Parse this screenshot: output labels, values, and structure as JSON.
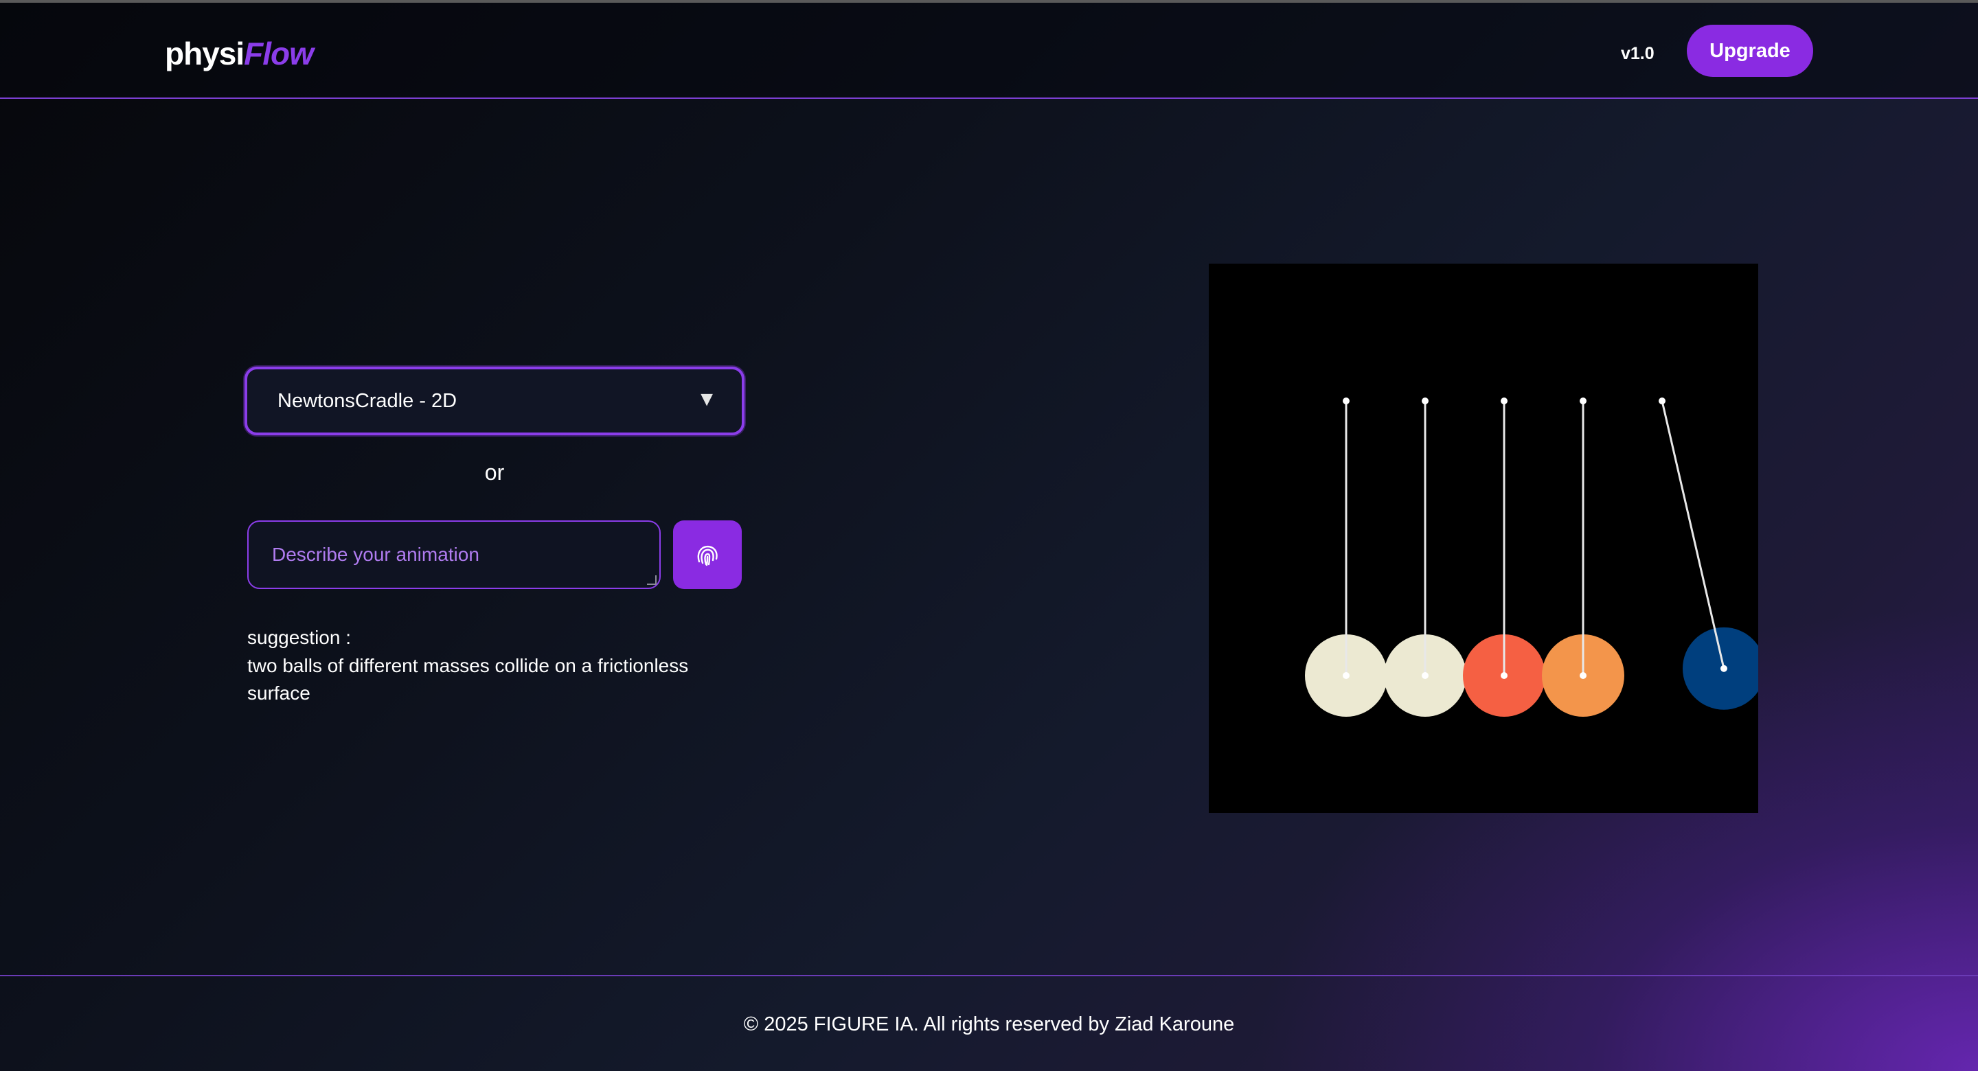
{
  "header": {
    "logo_part1": "physi",
    "logo_part2": "Flow",
    "version": "v1.0",
    "upgrade_label": "Upgrade"
  },
  "controls": {
    "selected_animation": "NewtonsCradle - 2D",
    "dropdown_arrow": "▼",
    "or_label": "or",
    "prompt_placeholder": "Describe your animation",
    "send_icon": "fingerprint-icon",
    "suggestion_title": "suggestion :",
    "suggestion_text": "two balls of different masses collide on a frictionless surface"
  },
  "animation": {
    "canvas_background": "#000000",
    "string_color": "#e8e8e8",
    "balls": [
      {
        "color": "#ece9d2",
        "swing_deg": 0
      },
      {
        "color": "#ece9d2",
        "swing_deg": 0
      },
      {
        "color": "#f56043",
        "swing_deg": 0
      },
      {
        "color": "#f3954b",
        "swing_deg": 0
      },
      {
        "color": "#003f7e",
        "swing_deg": 13
      }
    ]
  },
  "footer": {
    "copyright": "© 2025 FIGURE IA. All rights reserved by Ziad Karoune"
  },
  "colors": {
    "accent": "#8a2be2",
    "accent_border": "#8b3dea"
  }
}
